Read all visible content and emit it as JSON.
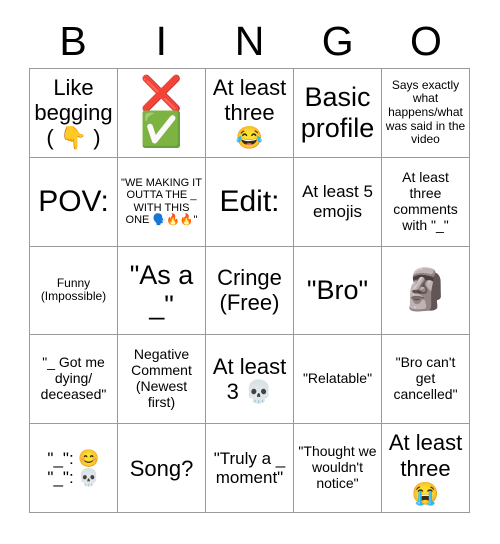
{
  "header": {
    "letters": [
      "B",
      "I",
      "N",
      "G",
      "O"
    ]
  },
  "grid": {
    "rows": 5,
    "columns": 5,
    "border_color": "#9a9a9a",
    "background": "#ffffff",
    "text_color": "#000000"
  },
  "cells": [
    {
      "id": "b1",
      "text": "Like begging ( 👇 )",
      "size": "lg"
    },
    {
      "id": "i1",
      "text": "❌\n✅",
      "size": "emoji"
    },
    {
      "id": "n1",
      "text": "At least three 😂",
      "size": "lg"
    },
    {
      "id": "g1",
      "text": "Basic profile",
      "size": "xl"
    },
    {
      "id": "o1",
      "text": "Says exactly what happens/what was said in the video",
      "size": "xs"
    },
    {
      "id": "b2",
      "text": "POV:",
      "size": "xxl"
    },
    {
      "id": "i2",
      "text": "\"WE MAKING IT OUTTA THE _ WITH THIS ONE 🗣️🔥🔥\"",
      "size": "xxs"
    },
    {
      "id": "n2",
      "text": "Edit:",
      "size": "xxl"
    },
    {
      "id": "g2",
      "text": "At least 5 emojis",
      "size": "md"
    },
    {
      "id": "o2",
      "text": "At least three comments with \"_\"",
      "size": "sm"
    },
    {
      "id": "b3",
      "text": "Funny (Impossible)",
      "size": "xs"
    },
    {
      "id": "i3",
      "text": "\"As a _\"",
      "size": "xl"
    },
    {
      "id": "n3",
      "text": "Cringe (Free)",
      "size": "lg"
    },
    {
      "id": "g3",
      "text": "\"Bro\"",
      "size": "xl"
    },
    {
      "id": "o3",
      "text": "🗿",
      "size": "emoji-single"
    },
    {
      "id": "b4",
      "text": "\"_ Got me dying/ deceased\"",
      "size": "sm"
    },
    {
      "id": "i4",
      "text": "Negative Comment (Newest first)",
      "size": "sm"
    },
    {
      "id": "n4",
      "text": "At least 3 💀",
      "size": "lg"
    },
    {
      "id": "g4",
      "text": "\"Relatable\"",
      "size": "sm"
    },
    {
      "id": "o4",
      "text": "\"Bro can't get cancelled\"",
      "size": "sm"
    },
    {
      "id": "b5",
      "text": "\"_\": 😊\n\"_\": 💀",
      "size": "md"
    },
    {
      "id": "i5",
      "text": "Song?",
      "size": "lg"
    },
    {
      "id": "n5",
      "text": "\"Truly a _ moment\"",
      "size": "md"
    },
    {
      "id": "g5",
      "text": "\"Thought we wouldn't notice\"",
      "size": "sm"
    },
    {
      "id": "o5",
      "text": "At least three 😭",
      "size": "lg"
    }
  ]
}
